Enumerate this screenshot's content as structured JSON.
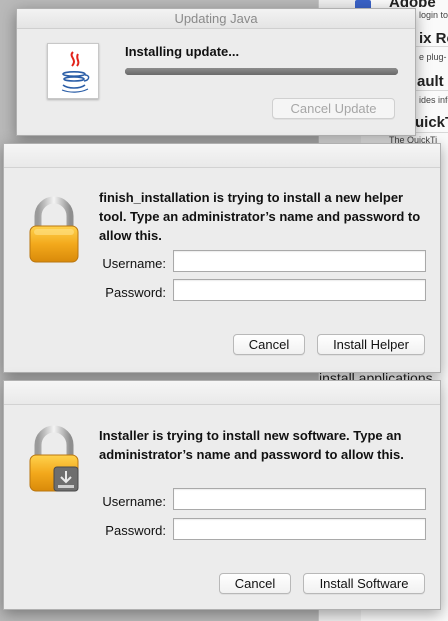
{
  "background_window": {
    "lines": [
      {
        "text": "Adobe",
        "style": "h"
      },
      {
        "text": "login to d",
        "style": "s"
      },
      {
        "text": "ix Re",
        "style": "h"
      },
      {
        "text": "e plug-",
        "style": "s"
      },
      {
        "text": "ault",
        "style": "h"
      },
      {
        "text": "ides info",
        "style": "s"
      },
      {
        "text": "uickTi",
        "style": "h"
      },
      {
        "text": "The QuickTi",
        "style": "s"
      },
      {
        "text": "install applications",
        "style": "m"
      }
    ]
  },
  "java_update": {
    "title": "Updating Java",
    "status": "Installing update...",
    "progress_percent": 100,
    "cancel_label": "Cancel Update"
  },
  "helper_dialog": {
    "message": "finish_installation is trying to install a new helper tool. Type an administrator’s name and password to allow this.",
    "username_label": "Username:",
    "password_label": "Password:",
    "username_value": "",
    "password_value": "",
    "cancel_label": "Cancel",
    "confirm_label": "Install Helper"
  },
  "software_dialog": {
    "message": "Installer is trying to install new software. Type an administrator’s name and password to allow this.",
    "username_label": "Username:",
    "password_label": "Password:",
    "username_value": "",
    "password_value": "",
    "cancel_label": "Cancel",
    "confirm_label": "Install Software"
  }
}
